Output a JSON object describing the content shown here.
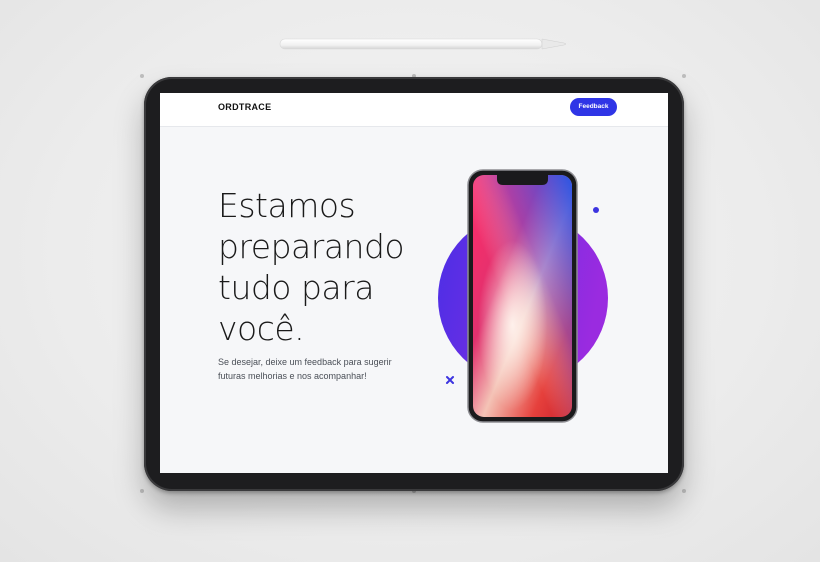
{
  "header": {
    "brand": "ORDTRACE",
    "feedback_label": "Feedback"
  },
  "hero": {
    "headline_lines": [
      "Estamos",
      "preparando",
      "tudo para",
      "você."
    ],
    "subtitle": "Se desejar, deixe um feedback para sugerir futuras melhorias e nos acompanhar!"
  },
  "colors": {
    "accent": "#2f35e6",
    "circle_start": "#4b2fe6",
    "circle_end": "#9a2be0",
    "tablet_bezel": "#1d1d1f",
    "screen_background": "#f6f7f9"
  },
  "icons": [
    "stylus-pencil",
    "phone-mockup",
    "decorative-circle",
    "decorative-dot",
    "decorative-cross"
  ]
}
